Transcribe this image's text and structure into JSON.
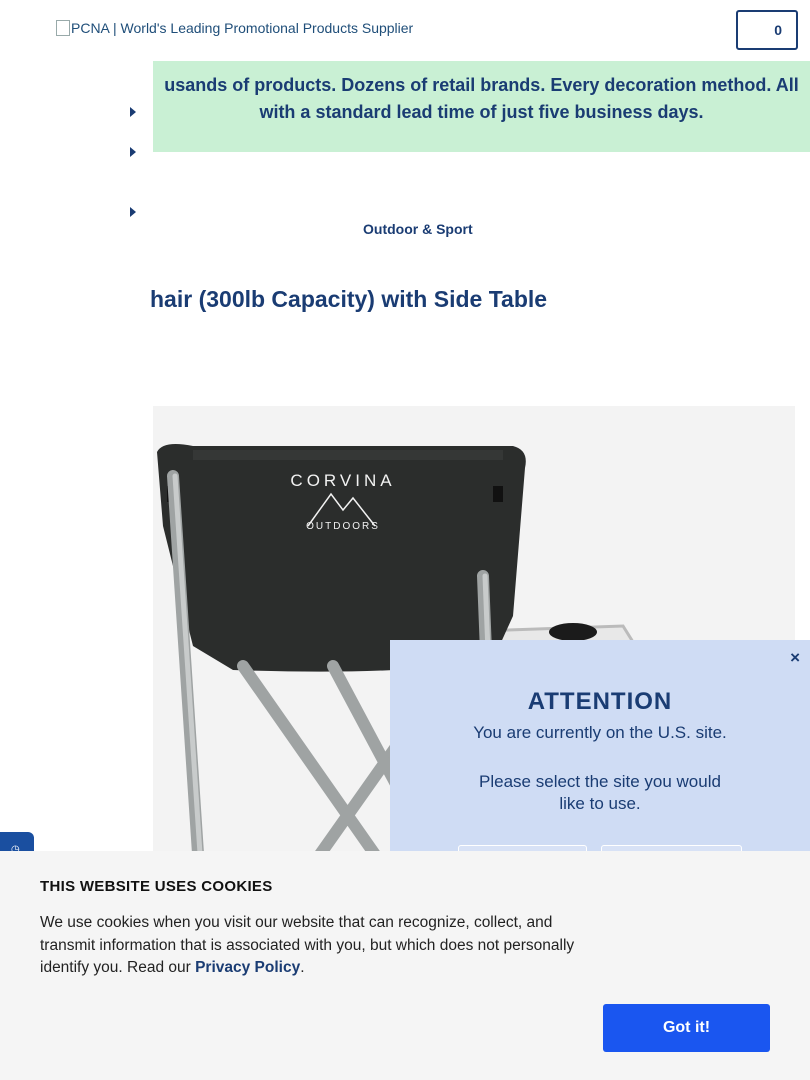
{
  "header": {
    "logo_alt": "PCNA | World's Leading Promotional Products Supplier",
    "cart_count": "0"
  },
  "promo": {
    "line1": "usands of products. Dozens of retail brands. Every decoration method. All",
    "line2": "with a standard lead time of just five business days."
  },
  "breadcrumb": {
    "category": "Outdoor & Sport"
  },
  "product": {
    "title": "hair (300lb Capacity) with Side Table",
    "image_brand_top": "CORVINA",
    "image_brand_bottom": "OUTDOORS"
  },
  "modal": {
    "close": "×",
    "title": "ATTENTION",
    "message": "You are currently on the U.S. site.",
    "prompt": "Please select the site you would like to use."
  },
  "cookie": {
    "title": "THIS WEBSITE USES COOKIES",
    "text": "We use cookies when you visit our website that can recognize, collect, and transmit information that is associated with you, but which does not personally identify you. Read our ",
    "link": "Privacy Policy",
    "tail": ".",
    "button": "Got it!"
  },
  "colors": {
    "brand_navy": "#1a3c73",
    "promo_bg": "#c9f0d4",
    "modal_bg": "#cfdcf4",
    "accept_button": "#1a56f0"
  }
}
